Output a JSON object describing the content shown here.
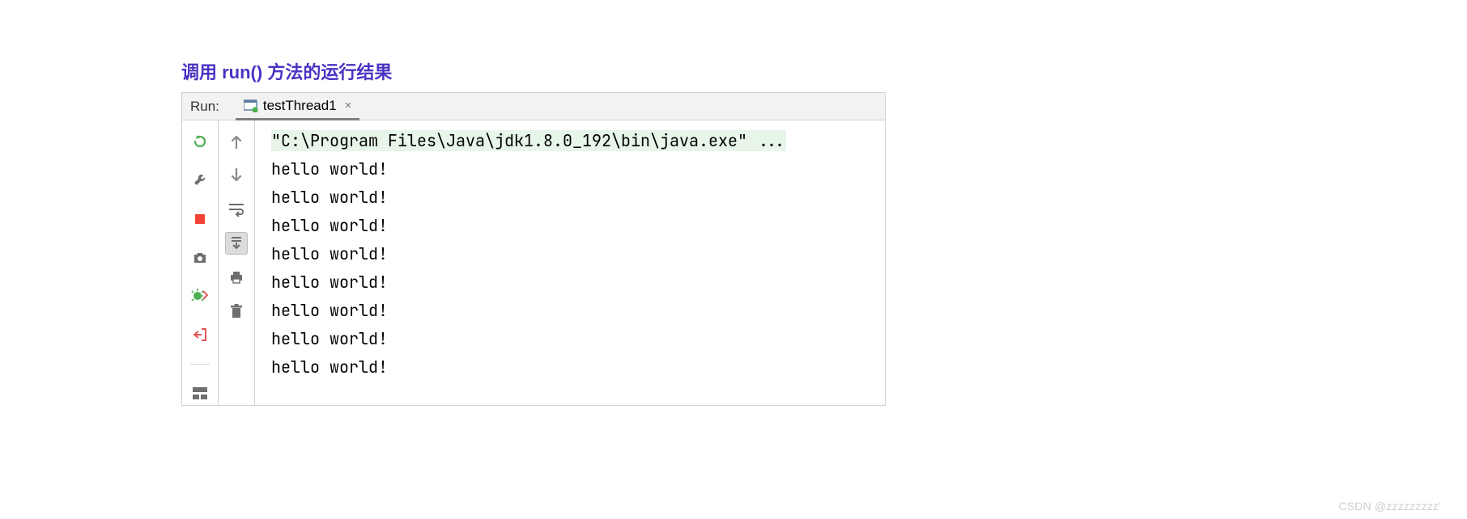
{
  "title": "调用 run()  方法的运行结果",
  "panel": {
    "run_label": "Run:",
    "tab_name": "testThread1"
  },
  "console": {
    "command": "\"C:\\Program Files\\Java\\jdk1.8.0_192\\bin\\java.exe\" ...",
    "lines": [
      "hello world!",
      "hello world!",
      "hello world!",
      "hello world!",
      "hello world!",
      "hello world!",
      "hello world!",
      "hello world!"
    ]
  },
  "icons": {
    "left_gutter": [
      "rerun-icon",
      "wrench-icon",
      "stop-icon",
      "camera-icon",
      "bug-debug-icon",
      "exit-icon",
      "layout-icon"
    ],
    "right_gutter": [
      "arrow-up-icon",
      "arrow-down-icon",
      "soft-wrap-icon",
      "scroll-to-end-icon",
      "print-icon",
      "trash-icon"
    ]
  },
  "watermark": "CSDN @zzzzzzzzz'"
}
